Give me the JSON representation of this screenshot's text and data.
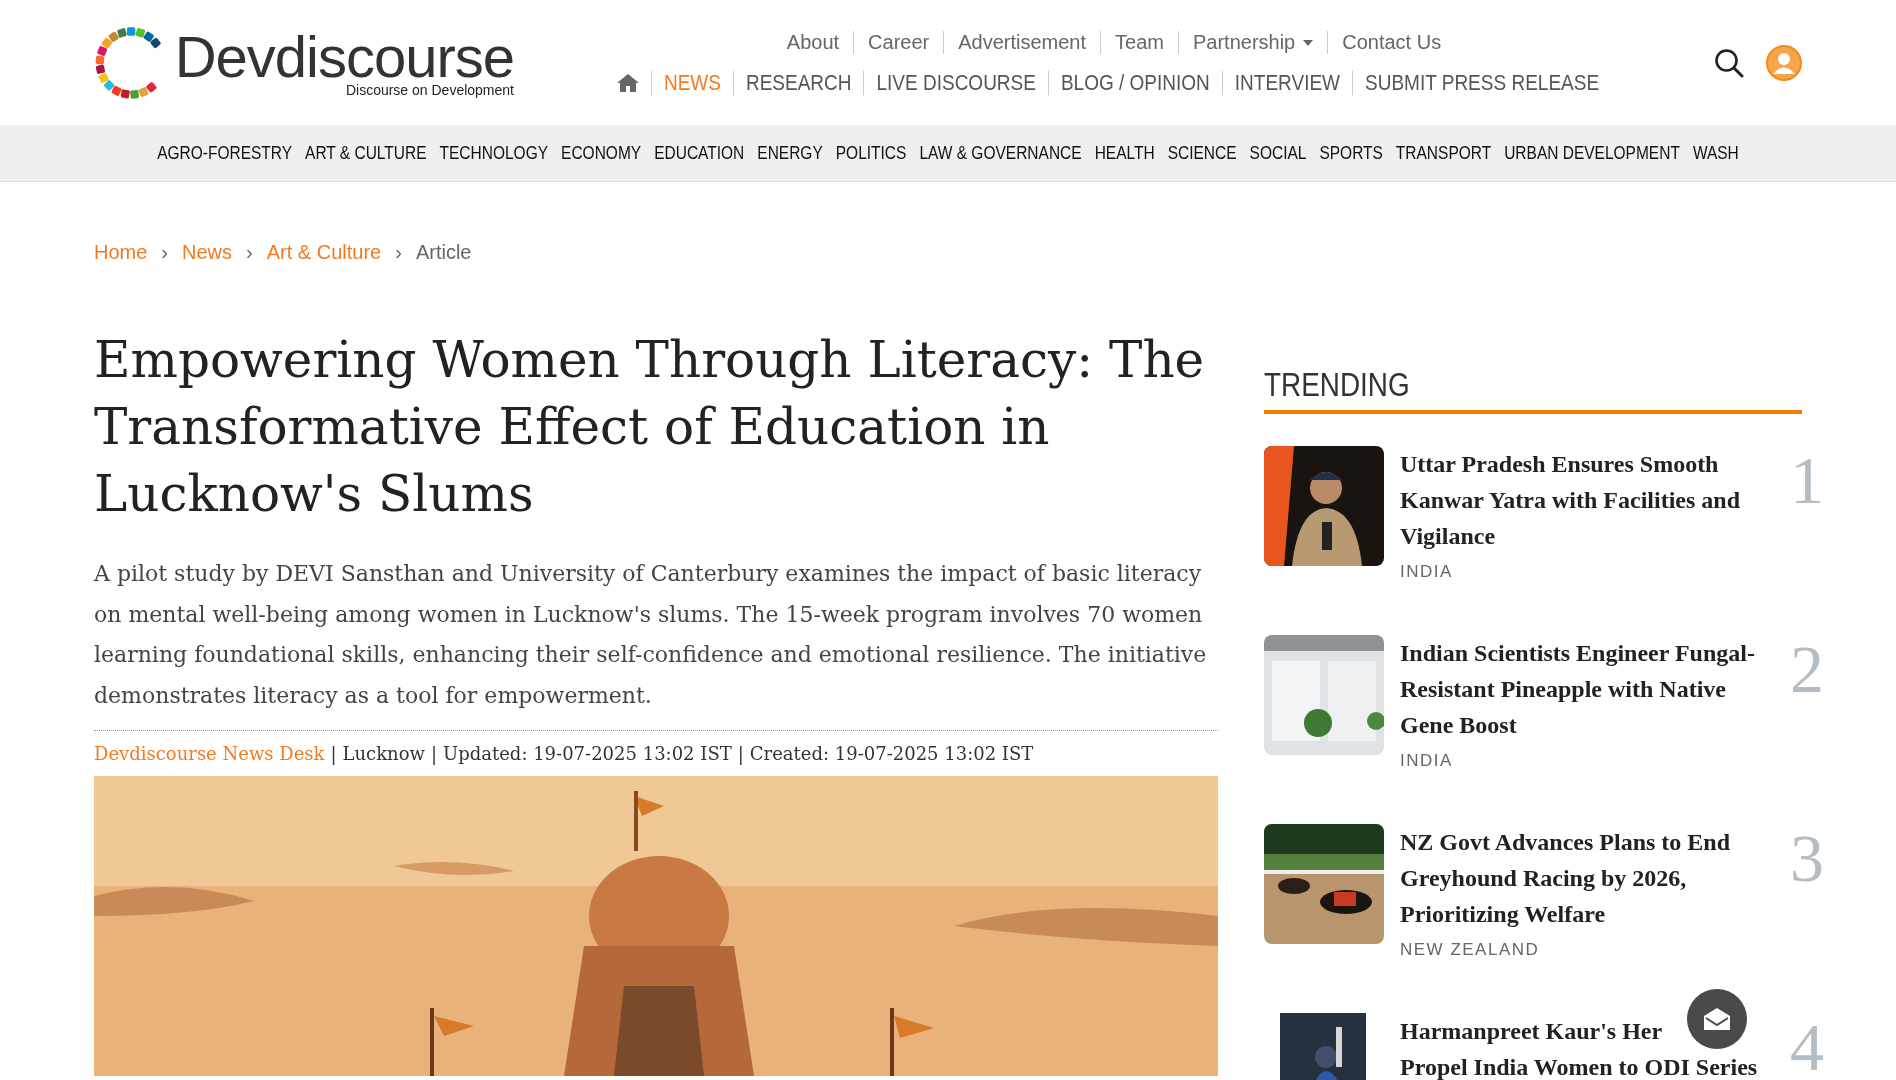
{
  "header": {
    "logo": {
      "name": "Devdiscourse",
      "tagline": "Discourse on Development"
    },
    "top_links": [
      {
        "label": "About",
        "kind": "link"
      },
      {
        "label": "Career",
        "kind": "link"
      },
      {
        "label": "Advertisement",
        "kind": "link"
      },
      {
        "label": "Team",
        "kind": "link"
      },
      {
        "label": "Partnership",
        "kind": "dropdown"
      },
      {
        "label": "Contact Us",
        "kind": "link"
      }
    ],
    "main_nav": [
      {
        "label": "NEWS",
        "selected": true
      },
      {
        "label": "RESEARCH",
        "selected": false
      },
      {
        "label": "LIVE DISCOURSE",
        "selected": false
      },
      {
        "label": "BLOG / OPINION",
        "selected": false
      },
      {
        "label": "INTERVIEW",
        "selected": false
      },
      {
        "label": "SUBMIT PRESS RELEASE",
        "selected": false
      }
    ]
  },
  "categories": [
    "AGRO-FORESTRY",
    "ART & CULTURE",
    "TECHNOLOGY",
    "ECONOMY",
    "EDUCATION",
    "ENERGY",
    "POLITICS",
    "LAW & GOVERNANCE",
    "HEALTH",
    "SCIENCE",
    "SOCIAL",
    "SPORTS",
    "TRANSPORT",
    "URBAN DEVELOPMENT",
    "WASH"
  ],
  "breadcrumb": {
    "separator": "›",
    "items": [
      {
        "label": "Home",
        "kind": "link"
      },
      {
        "label": "News",
        "kind": "link"
      },
      {
        "label": "Art & Culture",
        "kind": "link"
      },
      {
        "label": "Article",
        "kind": "current"
      }
    ]
  },
  "article": {
    "title": "Empowering Women Through Literacy: The Transformative Effect of Education in Lucknow's Slums",
    "summary": "A pilot study by DEVI Sansthan and University of Canterbury examines the impact of basic literacy on mental well-being among women in Lucknow's slums. The 15-week program involves 70 women learning foundational skills, enhancing their self-confidence and emotional resilience. The initiative demonstrates literacy as a tool for empowerment.",
    "meta": {
      "separator": "|",
      "author": "Devdiscourse News Desk",
      "parts": [
        "Lucknow",
        "Updated: 19-07-2025 13:02 IST",
        "Created: 19-07-2025 13:02 IST"
      ]
    }
  },
  "trending": {
    "title": "TRENDING",
    "items": [
      {
        "rank": "1",
        "title_lines": [
          "Uttar Pradesh Ensures Smooth Kanwar Yatra with Facilities and Vigilance"
        ],
        "region": "INDIA"
      },
      {
        "rank": "2",
        "title_lines": [
          "Indian Scientists Engineer Fungal-Resistant Pineapple with Native Gene Boost"
        ],
        "region": "INDIA"
      },
      {
        "rank": "3",
        "title_lines": [
          "NZ Govt Advances Plans to End Greyhound Racing by 2026, Prioritizing Welfare"
        ],
        "region": "NEW ZEALAND"
      },
      {
        "rank": "4",
        "title_lines": [
          "Harmanpreet Kaur's Her",
          "Propel India Women to ODI Series"
        ]
      }
    ]
  }
}
